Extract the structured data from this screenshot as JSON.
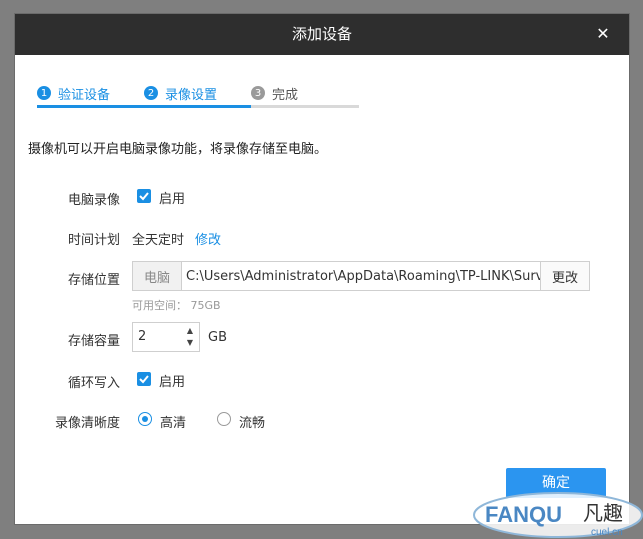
{
  "dialog": {
    "title": "添加设备",
    "close_glyph": "✕"
  },
  "steps": [
    {
      "num": "1",
      "label": "验证设备",
      "state": "done"
    },
    {
      "num": "2",
      "label": "录像设置",
      "state": "active"
    },
    {
      "num": "3",
      "label": "完成",
      "state": "pending"
    }
  ],
  "description": "摄像机可以开启电脑录像功能，将录像存储至电脑。",
  "form": {
    "pc_recording": {
      "label": "电脑录像",
      "checkbox_label": "启用",
      "checked": true
    },
    "schedule": {
      "label": "时间计划",
      "value": "全天定时",
      "edit_link": "修改"
    },
    "storage_location": {
      "label": "存储位置",
      "prefix": "电脑",
      "path": "C:\\Users\\Administrator\\AppData\\Roaming\\TP-LINK\\Surv",
      "change_button": "更改",
      "free_space": "可用空间： 75GB"
    },
    "storage_capacity": {
      "label": "存储容量",
      "value": "2",
      "unit": "GB"
    },
    "loop_write": {
      "label": "循环写入",
      "checkbox_label": "启用",
      "checked": true
    },
    "quality": {
      "label": "录像清晰度",
      "options": [
        {
          "label": "高清",
          "selected": true
        },
        {
          "label": "流畅",
          "selected": false
        }
      ]
    }
  },
  "footer": {
    "ok_button": "确定"
  },
  "watermark": {
    "text_latin": "FANQU",
    "text_cn": "凡趣",
    "domain": "cuel.cn"
  },
  "colors": {
    "accent": "#1a8fe3",
    "titlebar": "#2e2e2e",
    "overlay": "#7f7f7f"
  }
}
